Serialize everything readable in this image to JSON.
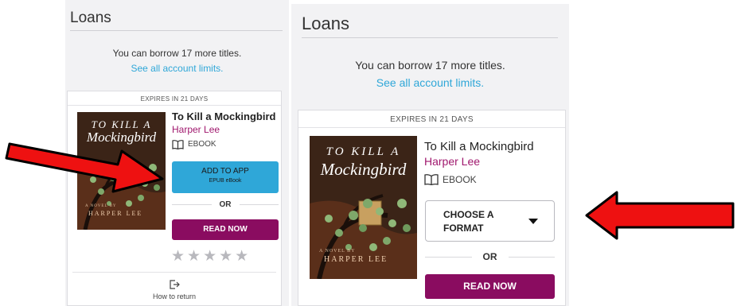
{
  "left": {
    "heading": "Loans",
    "borrow_text": "You can borrow 17 more titles.",
    "limits_link": "See all account limits.",
    "expires": "EXPIRES IN 21 DAYS",
    "cover": {
      "line1": "TO KILL A",
      "line2": "Mockingbird",
      "sub": "A NOVEL BY",
      "author": "HARPER LEE"
    },
    "book_title": "To Kill a Mockingbird",
    "book_author": "Harper Lee",
    "format_label": "EBOOK",
    "add_button": "ADD TO APP",
    "add_button_sub": "EPUB eBook",
    "or_label": "OR",
    "read_button": "READ NOW",
    "stars": "★★★★★",
    "how_to_return": "How to return"
  },
  "right": {
    "heading": "Loans",
    "borrow_text": "You can borrow 17 more titles.",
    "limits_link": "See all account limits.",
    "expires": "EXPIRES IN 21 DAYS",
    "cover": {
      "line1": "TO KILL A",
      "line2": "Mockingbird",
      "sub": "A NOVEL BY",
      "author": "HARPER LEE"
    },
    "book_title": "To Kill a Mockingbird",
    "book_author": "Harper Lee",
    "format_label": "EBOOK",
    "choose_line1": "CHOOSE A",
    "choose_line2": "FORMAT",
    "or_label": "OR",
    "read_button": "READ NOW"
  },
  "colors": {
    "accent_blue": "#2fa7d8",
    "read_button": "#8a0c60",
    "author_link": "#a0186e",
    "arrow_red": "#ee1111"
  }
}
